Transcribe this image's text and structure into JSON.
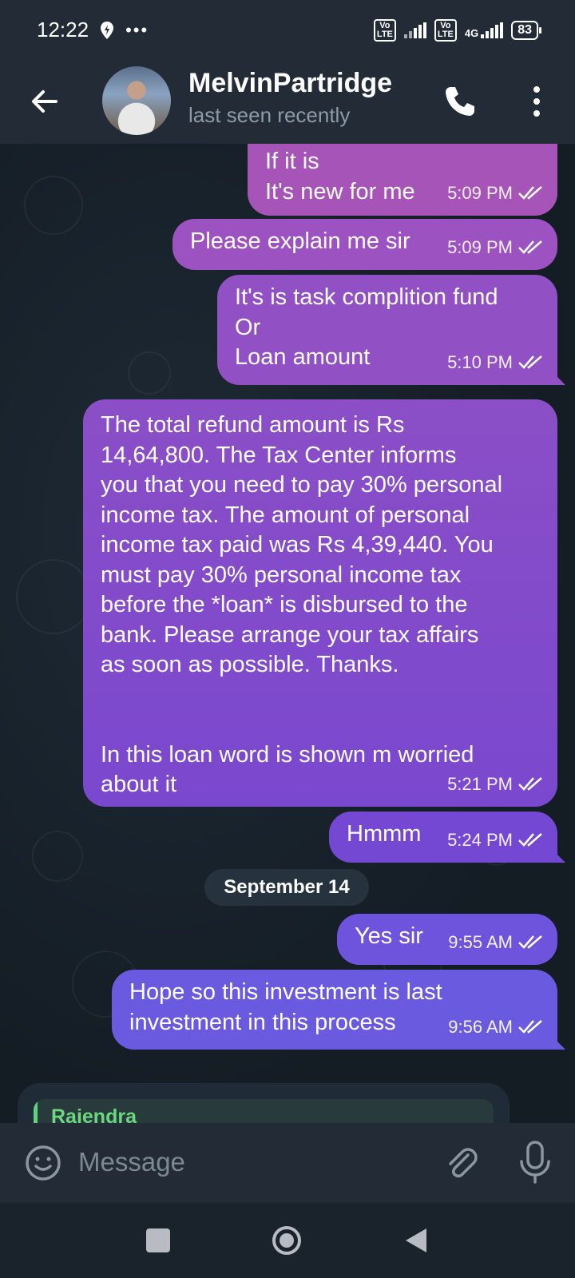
{
  "status_bar": {
    "time": "12:22",
    "volte1": "Vo\nLTE",
    "volte2": "Vo\nLTE",
    "network": "4G",
    "battery": "83"
  },
  "header": {
    "name": "MelvinPartridge",
    "status": "last seen recently"
  },
  "messages": [
    {
      "text": "If it is\nIt's new for me",
      "time": "5:09 PM"
    },
    {
      "text": "Please explain me sir",
      "time": "5:09 PM"
    },
    {
      "text": "It's is task complition fund\nOr\nLoan amount",
      "time": "5:10 PM"
    },
    {
      "text": "The total refund amount is Rs\n14,64,800. The Tax Center informs\nyou that you need to pay 30% personal\nincome tax. The amount of personal\nincome tax paid was Rs 4,39,440. You\nmust pay 30% personal income tax\nbefore the *loan* is disbursed to the\nbank. Please arrange your tax affairs\nas soon as possible. Thanks.\n\n\nIn this loan word is shown m worried\nabout it",
      "time": "5:21 PM"
    },
    {
      "text": "Hmmm",
      "time": "5:24 PM"
    },
    {
      "text": "Yes sir",
      "time": "9:55 AM"
    },
    {
      "text": "Hope so this investment is last\ninvestment in this process",
      "time": "9:56 AM"
    }
  ],
  "date_separator": "September 14",
  "reply_preview": {
    "name": "Rajendra"
  },
  "input": {
    "placeholder": "Message"
  },
  "colors": {
    "bubble_magenta": "#a754b8",
    "bubble_purple": "#7e4bcc",
    "bubble_indigo": "#6a5ae0",
    "reply_accent": "#5fd27e"
  }
}
